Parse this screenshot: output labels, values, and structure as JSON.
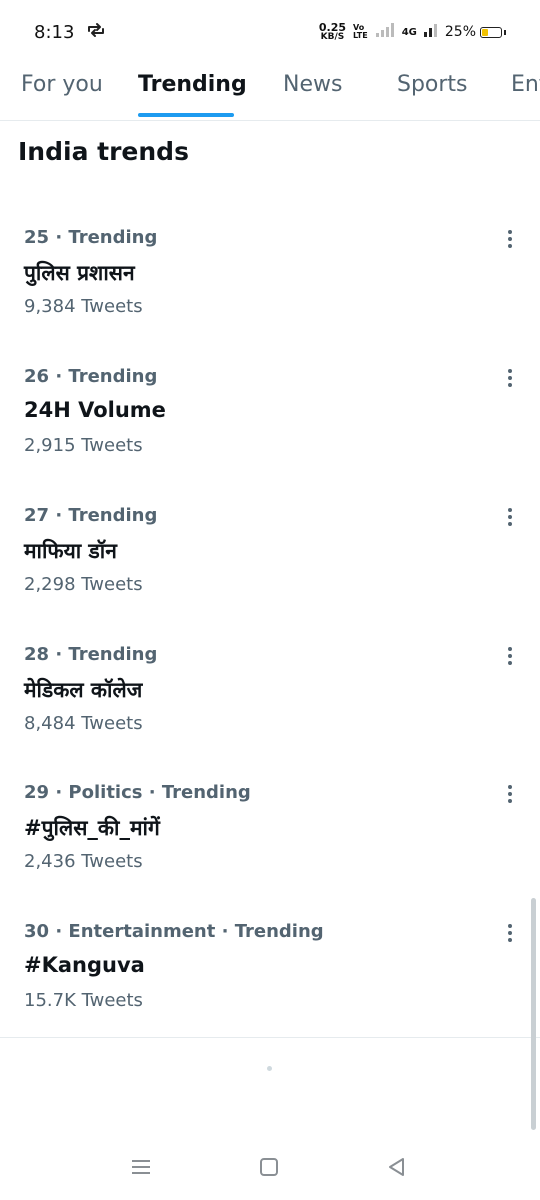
{
  "status": {
    "time": "8:13",
    "speed_value": "0.25",
    "speed_unit": "KB/S",
    "volte_top": "Vo",
    "volte_bottom": "LTE",
    "network": "4G",
    "battery": "25%"
  },
  "tabs": [
    "For you",
    "Trending",
    "News",
    "Sports",
    "Ent"
  ],
  "section_title": "India trends",
  "trends": [
    {
      "meta": "25 · Trending",
      "name": "पुलिस प्रशासन",
      "count": "9,384 Tweets"
    },
    {
      "meta": "26 · Trending",
      "name": "24H Volume",
      "count": "2,915 Tweets"
    },
    {
      "meta": "27 · Trending",
      "name": "माफिया डॉन",
      "count": "2,298 Tweets"
    },
    {
      "meta": "28 · Trending",
      "name": "मेडिकल कॉलेज",
      "count": "8,484 Tweets"
    },
    {
      "meta": "29 · Politics · Trending",
      "name": "#पुलिस_की_मांगें",
      "count": "2,436 Tweets"
    },
    {
      "meta": "30 · Entertainment · Trending",
      "name": "#Kanguva",
      "count": "15.7K Tweets"
    }
  ],
  "colors": {
    "accent": "#1d9bf0",
    "muted": "#536471",
    "text": "#0f1419",
    "battery": "#f2c200"
  },
  "icons": [
    "sync-icon",
    "signal-icon",
    "battery-icon",
    "more-vertical-icon",
    "menu-nav-icon",
    "home-nav-icon",
    "back-nav-icon"
  ]
}
